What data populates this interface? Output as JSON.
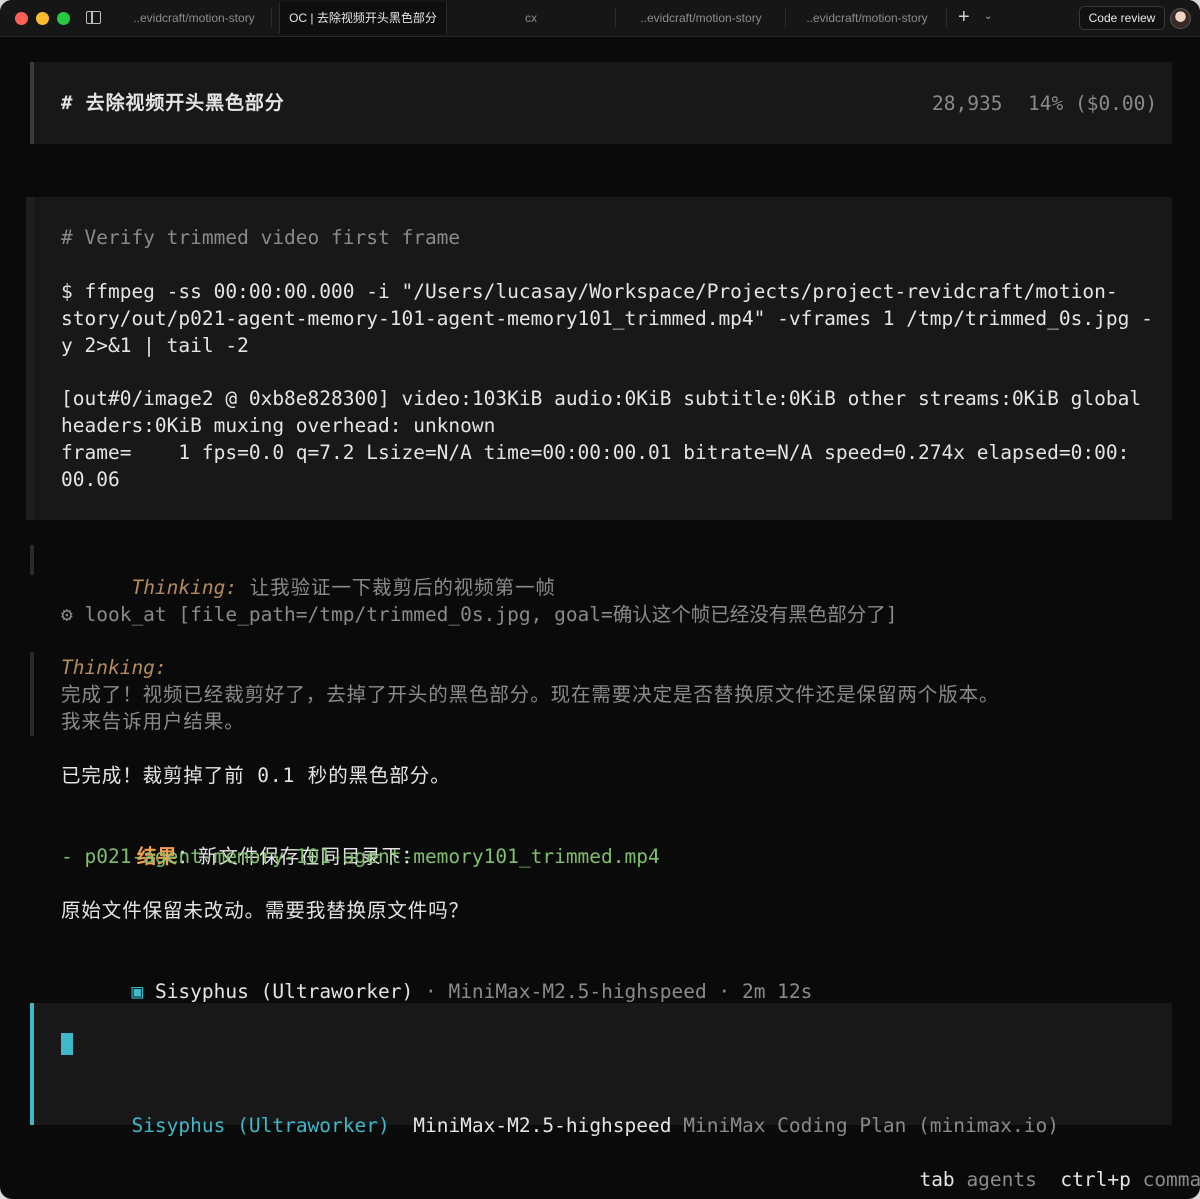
{
  "window": {
    "tabs": [
      {
        "label": "..evidcraft/motion-story"
      },
      {
        "label": "OC | 去除视频开头黑色部分"
      },
      {
        "label": "cx"
      },
      {
        "label": "..evidcraft/motion-story"
      },
      {
        "label": "..evidcraft/motion-story"
      }
    ],
    "code_review_label": "Code review",
    "new_tab_symbol": "+",
    "dropdown_symbol": "⌄"
  },
  "session": {
    "title": "# 去除视频开头黑色部分",
    "tokens": "28,935",
    "usage": "14% ($0.00)"
  },
  "tool_output": {
    "comment": "# Verify trimmed video first frame",
    "command_lines": [
      "$ ffmpeg -ss 00:00:00.000 -i \"/Users/lucasay/Workspace/Projects/project-revidcraft/motion-",
      "story/out/p021-agent-memory-101-agent-memory101_trimmed.mp4\" -vframes 1 /tmp/trimmed_0s.jpg -",
      "y 2>&1 | tail -2"
    ],
    "output_lines": [
      "[out#0/image2 @ 0xb8e828300] video:103KiB audio:0KiB subtitle:0KiB other streams:0KiB global",
      "headers:0KiB muxing overhead: unknown",
      "frame=    1 fps=0.0 q=7.2 Lsize=N/A time=00:00:00.01 bitrate=N/A speed=0.274x elapsed=0:00:",
      "00.06"
    ]
  },
  "thinking1": {
    "label": "Thinking:",
    "text": " 让我验证一下裁剪后的视频第一帧"
  },
  "tool_call": {
    "icon": "gear-icon",
    "text": "⚙ look_at [file_path=/tmp/trimmed_0s.jpg, goal=确认这个帧已经没有黑色部分了]"
  },
  "thinking2": {
    "label": "Thinking:",
    "lines": [
      "完成了！视频已经裁剪好了，去掉了开头的黑色部分。现在需要决定是否替换原文件还是保留两个版本。",
      "我来告诉用户结果。"
    ]
  },
  "response": {
    "line1": "已完成！裁剪掉了前 0.1 秒的黑色部分。",
    "result_label": "结果",
    "result_rest": "：新文件保存在同目录下：",
    "file_item": "- p021-agent-memory-101-agent-memory101_trimmed.mp4",
    "question": "原始文件保留未改动。需要我替换原文件吗？"
  },
  "agent_status": {
    "icon": "▣",
    "agent": "Sisyphus (Ultraworker)",
    "model": " · MiniMax-M2.5-highspeed · 2m 12s"
  },
  "prompt": {
    "agent": "Sisyphus (Ultraworker)",
    "model": "MiniMax-M2.5-highspeed",
    "provider": "MiniMax Coding Plan (minimax.io)"
  },
  "footer": {
    "key1": "tab",
    "label1": "agents",
    "key2": "ctrl+p",
    "label2": "commands"
  },
  "colors": {
    "accent": "#3fb8c8",
    "thinking": "#b58a5c",
    "highlight": "#f0a050",
    "file": "#7fbf6e"
  }
}
